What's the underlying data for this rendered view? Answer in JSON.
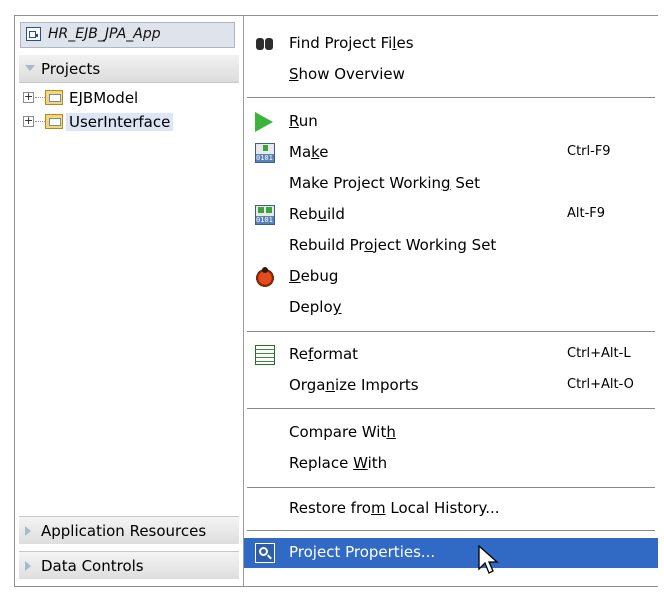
{
  "navigator": {
    "app_name": "HR_EJB_JPA_App",
    "projects_header": "Projects",
    "tree": [
      {
        "label": "EJBModel",
        "expander": "+"
      },
      {
        "label": "UserInterface",
        "expander": "+"
      }
    ],
    "accordions": [
      {
        "label": "Application Resources"
      },
      {
        "label": "Data Controls"
      }
    ]
  },
  "context_menu": {
    "items": [
      {
        "pre": "Find Project Fi",
        "u": "l",
        "post": "es",
        "shortcut": "",
        "icon": "binoculars-icon"
      },
      {
        "pre": "",
        "u": "S",
        "post": "how Overview",
        "shortcut": "",
        "icon": ""
      },
      {
        "pre": "",
        "u": "R",
        "post": "un",
        "shortcut": "",
        "icon": "run-icon"
      },
      {
        "pre": "Ma",
        "u": "k",
        "post": "e",
        "shortcut": "Ctrl-F9",
        "icon": "make-icon"
      },
      {
        "pre": "Make Project Workin",
        "u": "g",
        "post": " Set",
        "shortcut": "",
        "icon": ""
      },
      {
        "pre": "Reb",
        "u": "u",
        "post": "ild",
        "shortcut": "Alt-F9",
        "icon": "rebuild-icon"
      },
      {
        "pre": "Rebuild Pr",
        "u": "o",
        "post": "ject Working Set",
        "shortcut": "",
        "icon": ""
      },
      {
        "pre": "",
        "u": "D",
        "post": "ebug",
        "shortcut": "",
        "icon": "debug-bug-icon"
      },
      {
        "pre": "Deplo",
        "u": "y",
        "post": "",
        "shortcut": "",
        "icon": ""
      },
      {
        "pre": "Re",
        "u": "f",
        "post": "ormat",
        "shortcut": "Ctrl+Alt-L",
        "icon": "reformat-icon"
      },
      {
        "pre": "Orga",
        "u": "n",
        "post": "ize Imports",
        "shortcut": "Ctrl+Alt-O",
        "icon": ""
      },
      {
        "pre": "Compare Wit",
        "u": "h",
        "post": "",
        "shortcut": "",
        "icon": ""
      },
      {
        "pre": "Replace ",
        "u": "W",
        "post": "ith",
        "shortcut": "",
        "icon": ""
      },
      {
        "pre": "Restore fro",
        "u": "m",
        "post": " Local History...",
        "shortcut": "",
        "icon": ""
      },
      {
        "pre": "Pro",
        "u": "j",
        "post": "ect Properties...",
        "shortcut": "",
        "icon": "project-properties-icon"
      }
    ],
    "highlight_color": "#316ac5"
  }
}
